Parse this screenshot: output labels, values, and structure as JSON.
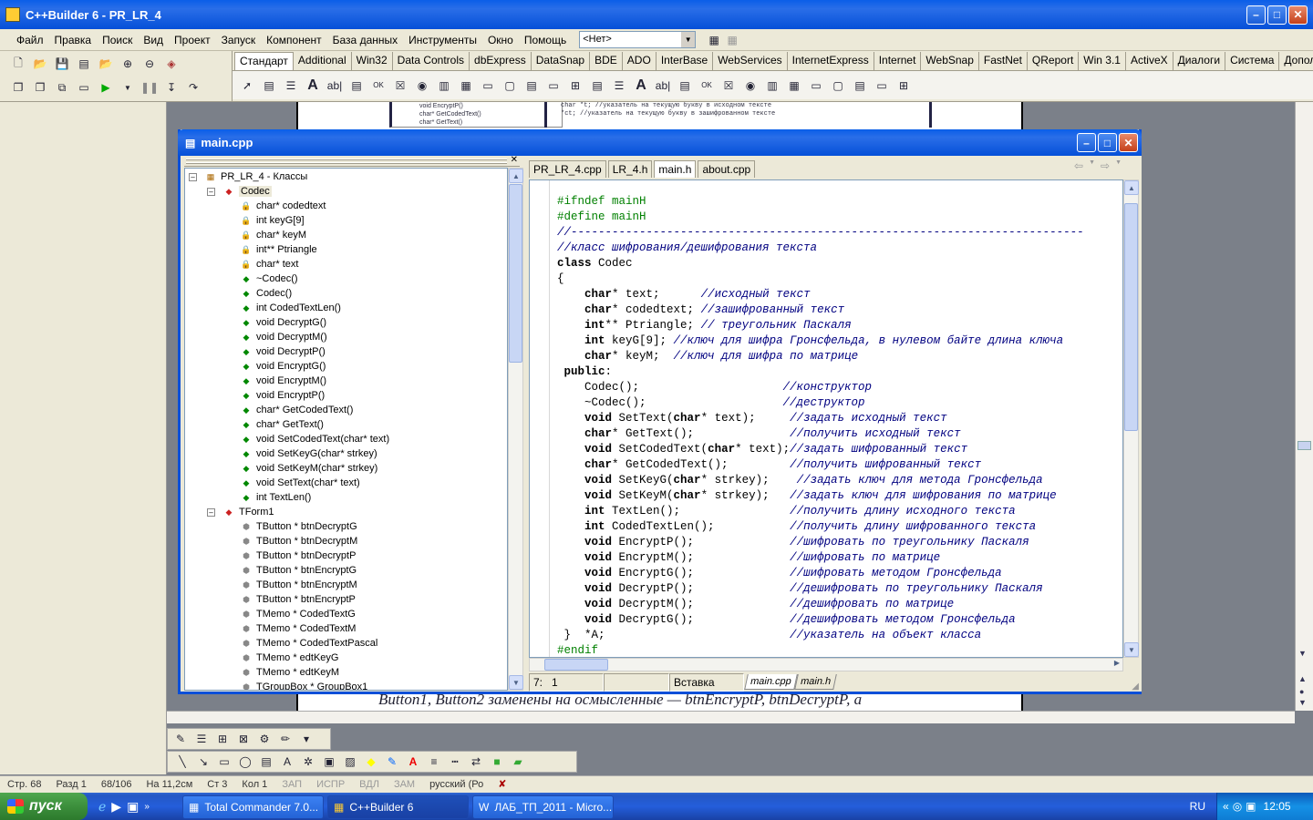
{
  "app": {
    "title": "C++Builder 6 - PR_LR_4"
  },
  "menu": [
    "Файл",
    "Правка",
    "Поиск",
    "Вид",
    "Проект",
    "Запуск",
    "Компонент",
    "База данных",
    "Инструменты",
    "Окно",
    "Помощь"
  ],
  "desktop_combo": "<Нет>",
  "palette_tabs": [
    "Стандарт",
    "Additional",
    "Win32",
    "Data Controls",
    "dbExpress",
    "DataSnap",
    "BDE",
    "ADO",
    "InterBase",
    "WebServices",
    "InternetExpress",
    "Internet",
    "WebSnap",
    "FastNet",
    "QReport",
    "Win 3.1",
    "ActiveX",
    "Диалоги",
    "Система",
    "Дополнител"
  ],
  "editor": {
    "title": "main.cpp",
    "tabs": [
      "PR_LR_4.cpp",
      "LR_4.h",
      "main.h",
      "about.cpp"
    ],
    "active_tab": 2,
    "bottom_tabs": [
      "main.cpp",
      "main.h"
    ],
    "status_pos": "7:   1",
    "status_mode": "Вставка"
  },
  "class_tree": {
    "root": "PR_LR_4 - Классы",
    "codec": {
      "name": "Codec",
      "members": [
        "char* codedtext",
        "int keyG[9]",
        "char* keyM",
        "int** Ptriangle",
        "char* text",
        "~Codec()",
        "Codec()",
        "int CodedTextLen()",
        "void DecryptG()",
        "void DecryptM()",
        "void DecryptP()",
        "void EncryptG()",
        "void EncryptM()",
        "void EncryptP()",
        "char* GetCodedText()",
        "char* GetText()",
        "void SetCodedText(char* text)",
        "void SetKeyG(char* strkey)",
        "void SetKeyM(char* strkey)",
        "void SetText(char* text)",
        "int TextLen()"
      ]
    },
    "tform": {
      "name": "TForm1",
      "members": [
        "TButton * btnDecryptG",
        "TButton * btnDecryptM",
        "TButton * btnDecryptP",
        "TButton * btnEncryptG",
        "TButton * btnEncryptM",
        "TButton * btnEncryptP",
        "TMemo * CodedTextG",
        "TMemo * CodedTextM",
        "TMemo * CodedTextPascal",
        "TMemo * edtKeyG",
        "TMemo * edtKeyM",
        "TGroupBox * GroupBox1"
      ]
    }
  },
  "code": [
    [
      [
        "pp",
        "#ifndef mainH"
      ]
    ],
    [
      [
        "pp",
        "#define mainH"
      ]
    ],
    [
      [
        "cm",
        "//---------------------------------------------------------------------------"
      ]
    ],
    [
      [
        "cm",
        "//класс шифрования/дешифрования текста"
      ]
    ],
    [
      [
        "kw",
        "class"
      ],
      [
        "t",
        " Codec"
      ]
    ],
    [
      [
        "t",
        "{"
      ]
    ],
    [
      [
        "t",
        "    "
      ],
      [
        "kw",
        "char"
      ],
      [
        "t",
        "* text;      "
      ],
      [
        "cm",
        "//исходный текст"
      ]
    ],
    [
      [
        "t",
        "    "
      ],
      [
        "kw",
        "char"
      ],
      [
        "t",
        "* codedtext; "
      ],
      [
        "cm",
        "//зашифрованный текст"
      ]
    ],
    [
      [
        "t",
        "    "
      ],
      [
        "kw",
        "int"
      ],
      [
        "t",
        "** Ptriangle; "
      ],
      [
        "cm",
        "// треугольник Паскаля"
      ]
    ],
    [
      [
        "t",
        "    "
      ],
      [
        "kw",
        "int"
      ],
      [
        "t",
        " keyG[9]; "
      ],
      [
        "cm",
        "//ключ для шифра Гронсфельда, в нулевом байте длина ключа"
      ]
    ],
    [
      [
        "t",
        "    "
      ],
      [
        "kw",
        "char"
      ],
      [
        "t",
        "* keyM;  "
      ],
      [
        "cm",
        "//ключ для шифра по матрице"
      ]
    ],
    [
      [
        "t",
        " "
      ],
      [
        "kw",
        "public"
      ],
      [
        "t",
        ":"
      ]
    ],
    [
      [
        "t",
        "    Codec();                     "
      ],
      [
        "cm",
        "//конструктор"
      ]
    ],
    [
      [
        "t",
        "    ~Codec();                    "
      ],
      [
        "cm",
        "//деструктор"
      ]
    ],
    [
      [
        "t",
        "    "
      ],
      [
        "kw",
        "void"
      ],
      [
        "t",
        " SetText("
      ],
      [
        "kw",
        "char"
      ],
      [
        "t",
        "* text);     "
      ],
      [
        "cm",
        "//задать исходный текст"
      ]
    ],
    [
      [
        "t",
        "    "
      ],
      [
        "kw",
        "char"
      ],
      [
        "t",
        "* GetText();              "
      ],
      [
        "cm",
        "//получить исходный текст"
      ]
    ],
    [
      [
        "t",
        "    "
      ],
      [
        "kw",
        "void"
      ],
      [
        "t",
        " SetCodedText("
      ],
      [
        "kw",
        "char"
      ],
      [
        "t",
        "* text);"
      ],
      [
        "cm",
        "//задать шифрованный текст"
      ]
    ],
    [
      [
        "t",
        "    "
      ],
      [
        "kw",
        "char"
      ],
      [
        "t",
        "* GetCodedText();         "
      ],
      [
        "cm",
        "//получить шифрованный текст"
      ]
    ],
    [
      [
        "t",
        "    "
      ],
      [
        "kw",
        "void"
      ],
      [
        "t",
        " SetKeyG("
      ],
      [
        "kw",
        "char"
      ],
      [
        "t",
        "* strkey);    "
      ],
      [
        "cm",
        "//задать ключ для метода Гронсфельда"
      ]
    ],
    [
      [
        "t",
        "    "
      ],
      [
        "kw",
        "void"
      ],
      [
        "t",
        " SetKeyM("
      ],
      [
        "kw",
        "char"
      ],
      [
        "t",
        "* strkey);   "
      ],
      [
        "cm",
        "//задать ключ для шифрования по матрице"
      ]
    ],
    [
      [
        "t",
        "    "
      ],
      [
        "kw",
        "int"
      ],
      [
        "t",
        " TextLen();                "
      ],
      [
        "cm",
        "//получить длину исходного текста"
      ]
    ],
    [
      [
        "t",
        "    "
      ],
      [
        "kw",
        "int"
      ],
      [
        "t",
        " CodedTextLen();           "
      ],
      [
        "cm",
        "//получить длину шифрованного текста"
      ]
    ],
    [
      [
        "t",
        "    "
      ],
      [
        "kw",
        "void"
      ],
      [
        "t",
        " EncryptP();              "
      ],
      [
        "cm",
        "//шифровать по треугольнику Паскаля"
      ]
    ],
    [
      [
        "t",
        "    "
      ],
      [
        "kw",
        "void"
      ],
      [
        "t",
        " EncryptM();              "
      ],
      [
        "cm",
        "//шифровать по матрице"
      ]
    ],
    [
      [
        "t",
        "    "
      ],
      [
        "kw",
        "void"
      ],
      [
        "t",
        " EncryptG();              "
      ],
      [
        "cm",
        "//шифровать методом Гронсфельда"
      ]
    ],
    [
      [
        "t",
        "    "
      ],
      [
        "kw",
        "void"
      ],
      [
        "t",
        " DecryptP();              "
      ],
      [
        "cm",
        "//дешифровать по треугольнику Паскаля"
      ]
    ],
    [
      [
        "t",
        "    "
      ],
      [
        "kw",
        "void"
      ],
      [
        "t",
        " DecryptM();              "
      ],
      [
        "cm",
        "//дешифровать по матрице"
      ]
    ],
    [
      [
        "t",
        "    "
      ],
      [
        "kw",
        "void"
      ],
      [
        "t",
        " DecryptG();              "
      ],
      [
        "cm",
        "//дешифровать методом Гронсфельда"
      ]
    ],
    [
      [
        "t",
        " }  *A;                           "
      ],
      [
        "cm",
        "//указатель на объект класса"
      ]
    ],
    [
      [
        "pp",
        "#endif"
      ]
    ]
  ],
  "word": {
    "status": [
      "Стр. 68",
      "Разд 1",
      "68/106",
      "На 11,2см",
      "Ст 3",
      "Кол 1",
      "ЗАП",
      "ИСПР",
      "ВДЛ",
      "ЗАМ",
      "русский (Ро"
    ],
    "doc_text": "Button1, Button2 заменены на осмысленные — btnEncryptP, btnDecryptP, а"
  },
  "taskbar": {
    "start": "пуск",
    "items": [
      "Total Commander 7.0...",
      "C++Builder 6",
      "ЛАБ_ТП_2011 - Micro..."
    ],
    "lang": "RU",
    "time": "12:05"
  }
}
